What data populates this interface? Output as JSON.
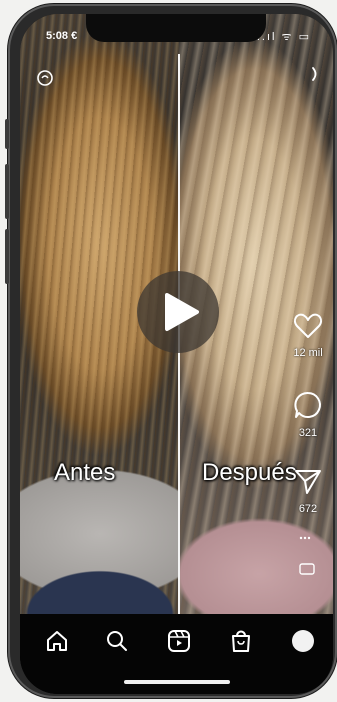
{
  "status_bar": {
    "time": "5:08 €",
    "icons_text": "..ıl ᯤ ▭"
  },
  "video": {
    "top_left_icon": "camera-icon",
    "top_right_icon": "more-icon",
    "caption_left": "Antes",
    "caption_right": "Después"
  },
  "actions": {
    "like_count": "12 mil",
    "comment_count": "321",
    "share_count": "672"
  },
  "nav": {
    "items": [
      "home-icon",
      "search-icon",
      "reels-icon",
      "shop-icon",
      "profile-avatar"
    ]
  },
  "colors": {
    "accent": "#ffffff",
    "background": "#000000"
  }
}
